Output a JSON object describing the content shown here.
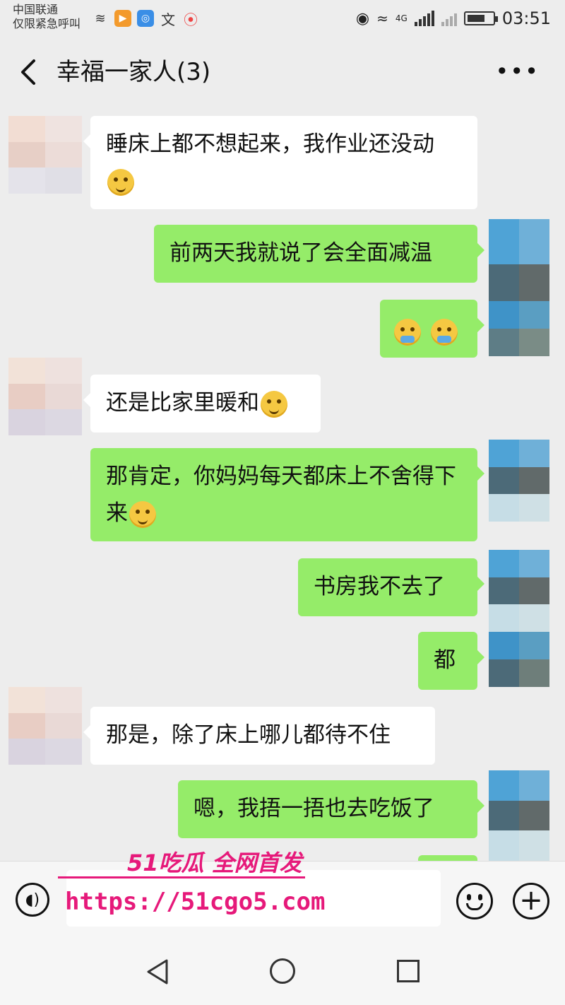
{
  "status_bar": {
    "carrier_line1": "中国联通",
    "carrier_line2": "仅限紧急呼叫",
    "network_label": "4G",
    "time": "03:51",
    "icons": [
      "signal-icon",
      "video-app-icon",
      "wifi-app-icon",
      "translate-icon",
      "location-icon",
      "eye-icon",
      "wifi-icon",
      "battery-icon"
    ]
  },
  "header": {
    "title": "幸福一家人(3)",
    "back_icon": "chevron-left-icon",
    "menu_icon": "more-icon"
  },
  "messages": [
    {
      "side": "in",
      "text": "睡床上都不想起来，我作业还没动",
      "emoji": "sleepy-emoji"
    },
    {
      "side": "out",
      "text": "前两天我就说了会全面减温"
    },
    {
      "side": "out",
      "text": "",
      "emoji": "cry-laugh-emoji ×2"
    },
    {
      "side": "in",
      "text": "还是比家里暖和",
      "emoji": "surprised-emoji"
    },
    {
      "side": "out",
      "text": "那肯定，你妈妈每天都床上不舍得下来",
      "emoji": "grin-cover-emoji"
    },
    {
      "side": "out",
      "text": "书房我不去了"
    },
    {
      "side": "out",
      "text": "都"
    },
    {
      "side": "in",
      "text": "那是，除了床上哪儿都待不住"
    },
    {
      "side": "out",
      "text": "嗯，我捂一捂也去吃饭了"
    }
  ],
  "watermark": {
    "title": "51吃瓜 全网首发",
    "url": "https://51cgo5.com"
  },
  "colors": {
    "background": "#ededed",
    "outgoing_bubble": "#95ec69",
    "incoming_bubble": "#ffffff",
    "watermark": "#e6197a"
  }
}
